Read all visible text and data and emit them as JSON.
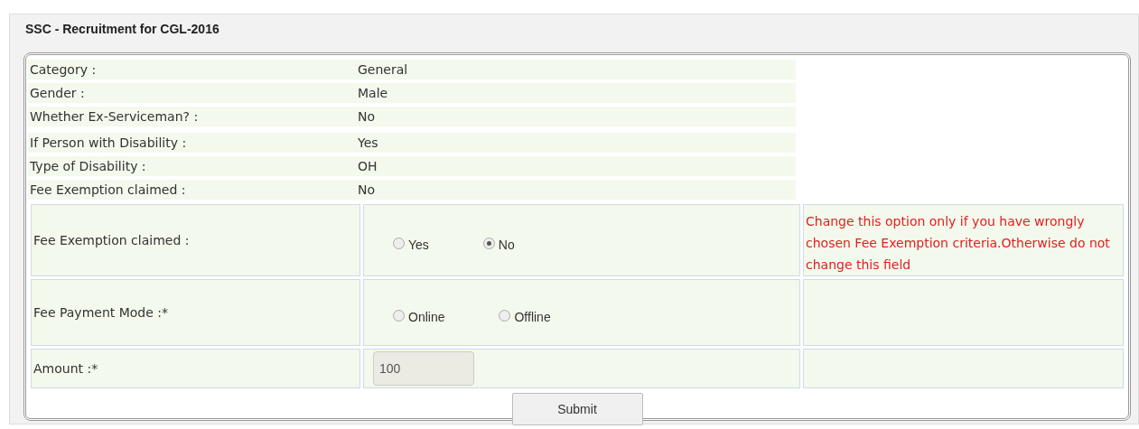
{
  "window": {
    "title": "SSC - Recruitment for CGL-2016"
  },
  "details": [
    {
      "label": "Category :",
      "value": "General"
    },
    {
      "label": "Gender :",
      "value": "Male"
    },
    {
      "label": "Whether Ex-Serviceman? :",
      "value": "No"
    },
    {
      "label": "If Person with Disability :",
      "value": "Yes"
    },
    {
      "label": "Type of Disability :",
      "value": "OH"
    },
    {
      "label": "Fee Exemption claimed :",
      "value": "No"
    }
  ],
  "form_rows": [
    {
      "kind": "radio",
      "label": "Fee Exemption claimed :",
      "options": [
        {
          "label": "Yes",
          "selected": false
        },
        {
          "label": "No",
          "selected": true
        }
      ],
      "note": "Change this option only if you have wrongly chosen Fee Exemption criteria.Otherwise do not change this field"
    },
    {
      "kind": "radio",
      "label": "Fee Payment Mode :*",
      "options": [
        {
          "label": "Online",
          "selected": false
        },
        {
          "label": "Offline",
          "selected": false
        }
      ]
    },
    {
      "kind": "input",
      "label": "Amount :*",
      "value": "100",
      "disabled": true
    }
  ],
  "submit": "Submit"
}
